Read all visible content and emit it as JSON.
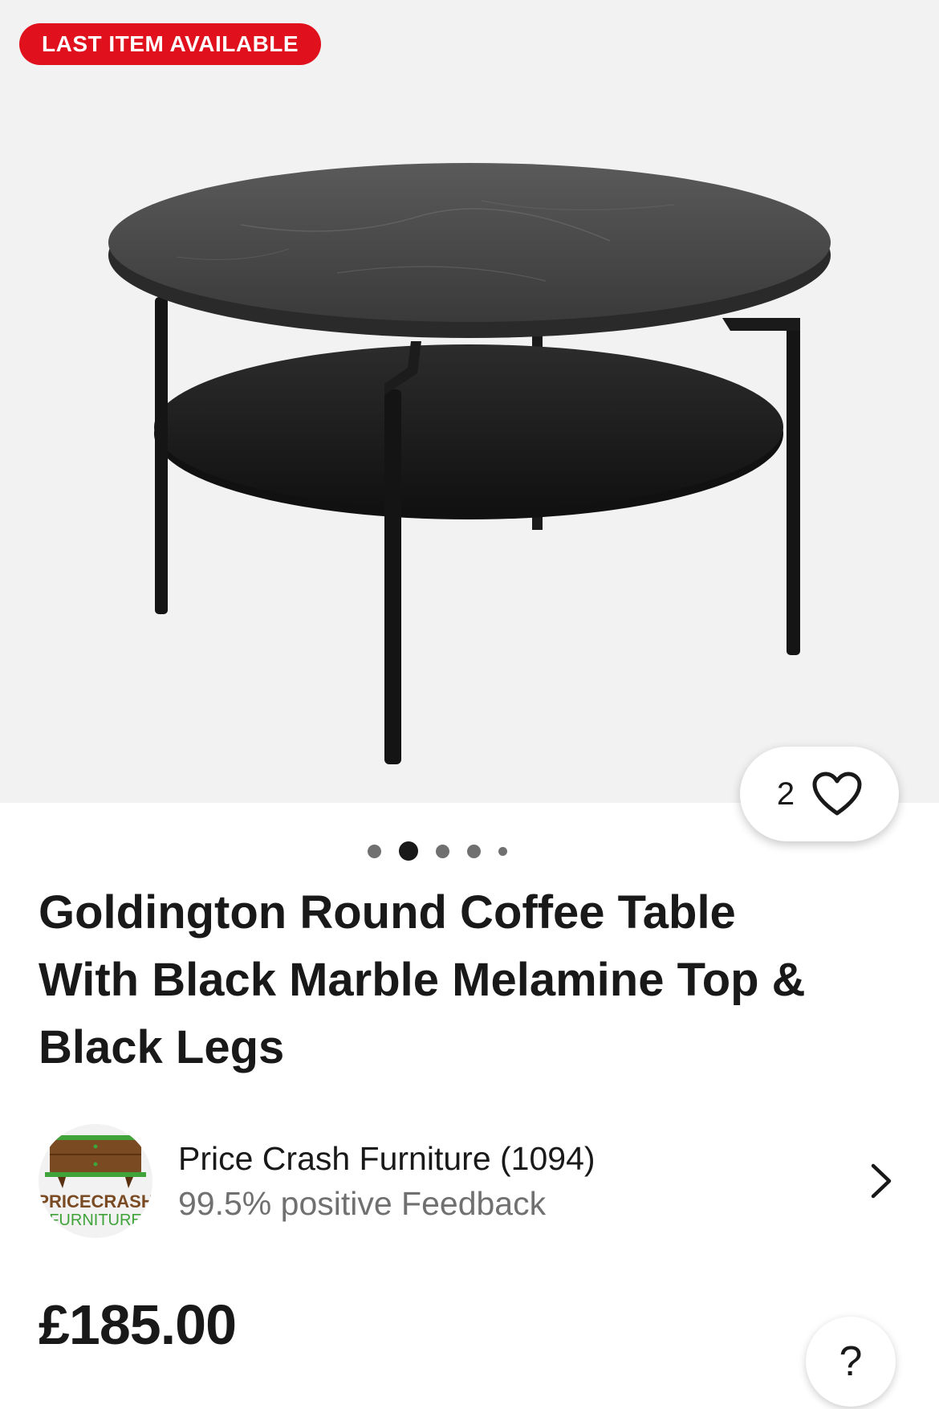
{
  "hero": {
    "badge": "LAST ITEM AVAILABLE",
    "image_alt": "Round coffee table with black marble top and lower shelf",
    "gallery": {
      "total_images": 5,
      "active_index": 1
    }
  },
  "watch": {
    "count": "2",
    "icon": "heart-icon"
  },
  "product": {
    "title_line1": "Goldington Round Coffee Table",
    "title_line2": "With Black Marble Melamine Top &",
    "title_line3": "Black Legs"
  },
  "seller": {
    "name": "Price Crash Furniture (1094)",
    "feedback": "99.5% positive Feedback",
    "logo_text_top": "PRICECRASH",
    "logo_text_bottom": "FURNITURE"
  },
  "price": "£185.00",
  "help": {
    "label": "?"
  },
  "colors": {
    "badge_bg": "#e0101d",
    "text_primary": "#191919",
    "text_secondary": "#707070",
    "hero_bg": "#f2f2f2"
  }
}
